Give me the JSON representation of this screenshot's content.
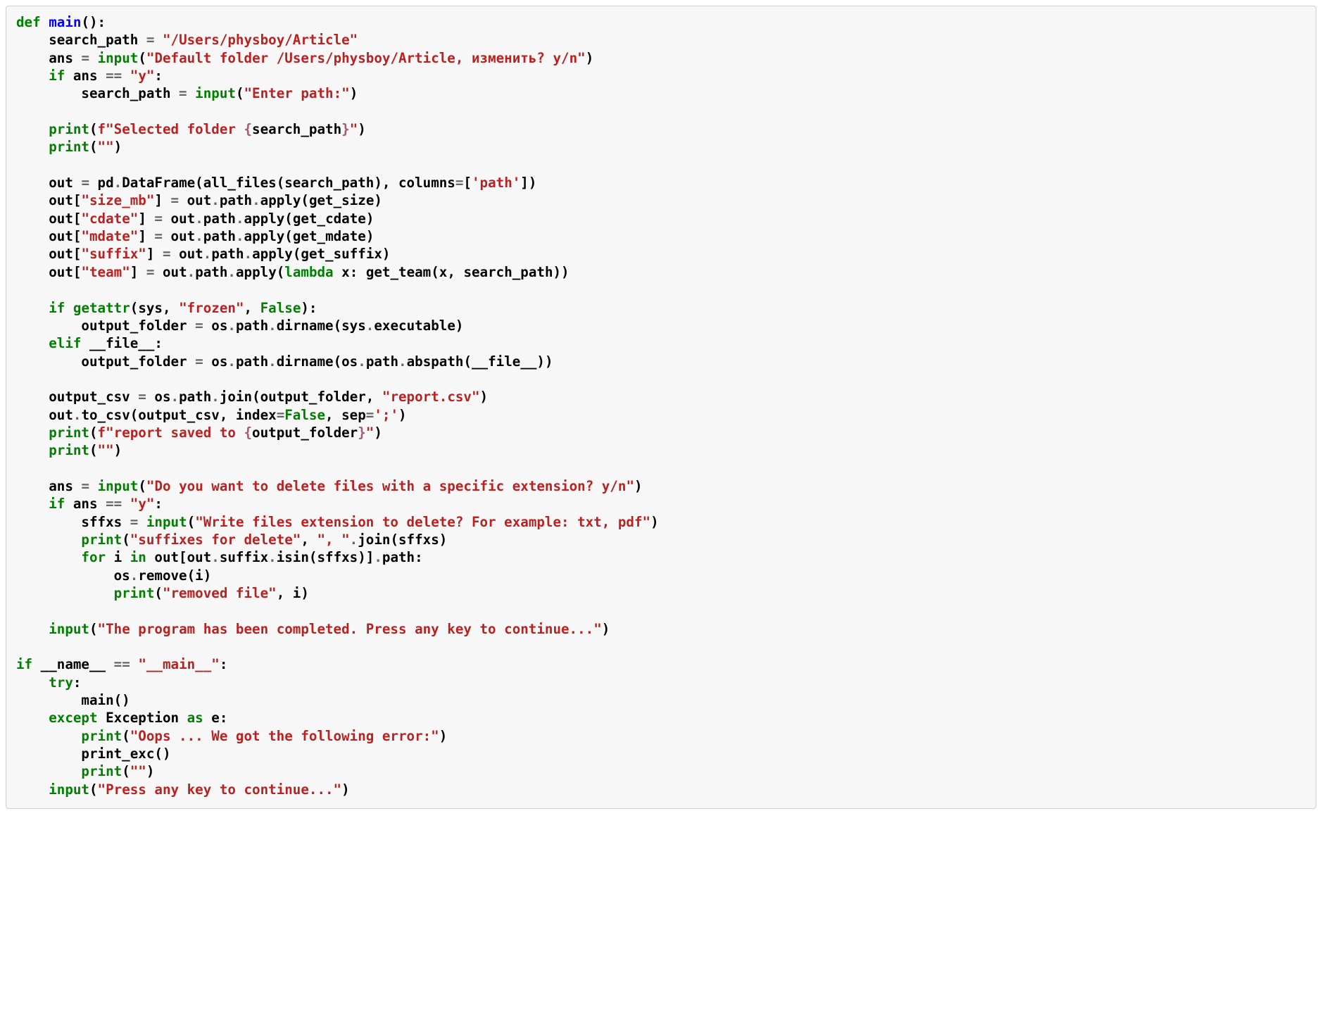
{
  "code": {
    "line1": {
      "def": "def",
      "sp": " ",
      "name": "main",
      "paren": "():"
    },
    "line2": {
      "indent": "    ",
      "v": "search_path ",
      "eq": "=",
      "sp": " ",
      "s": "\"/Users/physboy/Article\""
    },
    "line3": {
      "indent": "    ",
      "v": "ans ",
      "eq": "=",
      "sp": " ",
      "fn": "input",
      "open": "(",
      "s": "\"Default folder /Users/physboy/Article, изменить? y/n\"",
      "close": ")"
    },
    "line4": {
      "indent": "    ",
      "kw": "if",
      "cond": " ans ",
      "op": "==",
      "sp": " ",
      "s": "\"y\"",
      "colon": ":"
    },
    "line5": {
      "indent": "        ",
      "v": "search_path ",
      "eq": "=",
      "sp": " ",
      "fn": "input",
      "open": "(",
      "s": "\"Enter path:\"",
      "close": ")"
    },
    "line6": {
      "indent": "    ",
      "fn": "print",
      "open": "(",
      "pre": "f\"Selected folder ",
      "si_open": "{",
      "var": "search_path",
      "si_close": "}",
      "post": "\"",
      "close": ")"
    },
    "line7": {
      "indent": "    ",
      "fn": "print",
      "open": "(",
      "s": "\"\"",
      "close": ")"
    },
    "line8": {
      "indent": "    ",
      "lhs": "out ",
      "eq": "=",
      "rhs": " pd",
      "dot": ".",
      "m": "DataFrame(all_files(search_path), columns",
      "eq2": "=",
      "br": "[",
      "s": "'path'",
      "brc": "])"
    },
    "line9": {
      "indent": "    ",
      "lhs": "out[",
      "s": "\"size_mb\"",
      "mid": "] ",
      "eq": "=",
      "rhs": " out",
      "dot": ".",
      "tail": "path",
      "dot2": ".",
      "ap": "apply(get_size)"
    },
    "line10": {
      "indent": "    ",
      "lhs": "out[",
      "s": "\"cdate\"",
      "mid": "] ",
      "eq": "=",
      "rhs": " out",
      "dot": ".",
      "tail": "path",
      "dot2": ".",
      "ap": "apply(get_cdate)"
    },
    "line11": {
      "indent": "    ",
      "lhs": "out[",
      "s": "\"mdate\"",
      "mid": "] ",
      "eq": "=",
      "rhs": " out",
      "dot": ".",
      "tail": "path",
      "dot2": ".",
      "ap": "apply(get_mdate)"
    },
    "line12": {
      "indent": "    ",
      "lhs": "out[",
      "s": "\"suffix\"",
      "mid": "] ",
      "eq": "=",
      "rhs": " out",
      "dot": ".",
      "tail": "path",
      "dot2": ".",
      "ap": "apply(get_suffix)"
    },
    "line13": {
      "indent": "    ",
      "lhs": "out[",
      "s": "\"team\"",
      "mid": "] ",
      "eq": "=",
      "rhs": " out",
      "dot": ".",
      "tail": "path",
      "dot2": ".",
      "ap": "apply(",
      "kw": "lambda",
      "body": " x: get_team(x, search_path))"
    },
    "line14": {
      "indent": "    ",
      "kw": "if",
      "sp": " ",
      "fn": "getattr",
      "open": "(sys, ",
      "s": "\"frozen\"",
      "comma": ", ",
      "kc": "False",
      "close": "):"
    },
    "line15": {
      "indent": "        ",
      "v": "output_folder ",
      "eq": "=",
      "rhs": " os",
      "dot": ".",
      "tail": "path",
      "dot2": ".",
      "m": "dirname(sys",
      "dot3": ".",
      "exe": "executable)"
    },
    "line16": {
      "indent": "    ",
      "kw": "elif",
      "sp": " ",
      "v": "__file__",
      "colon": ":"
    },
    "line17": {
      "indent": "        ",
      "v": "output_folder ",
      "eq": "=",
      "rhs": " os",
      "dot": ".",
      "tail": "path",
      "dot2": ".",
      "m": "dirname(os",
      "dot3": ".",
      "p2": "path",
      "dot4": ".",
      "abs": "abspath(__file__))"
    },
    "line18": {
      "indent": "    ",
      "v": "output_csv ",
      "eq": "=",
      "rhs": " os",
      "dot": ".",
      "tail": "path",
      "dot2": ".",
      "m": "join(output_folder, ",
      "s": "\"report.csv\"",
      "close": ")"
    },
    "line19": {
      "indent": "    ",
      "lhs": "out",
      "dot": ".",
      "m": "to_csv(output_csv, index",
      "eq": "=",
      "kc": "False",
      "comma": ", sep",
      "eq2": "=",
      "s": "';'",
      "close": ")"
    },
    "line20": {
      "indent": "    ",
      "fn": "print",
      "open": "(",
      "pre": "f\"report saved to ",
      "si_open": "{",
      "var": "output_folder",
      "si_close": "}",
      "post": "\"",
      "close": ")"
    },
    "line21": {
      "indent": "    ",
      "fn": "print",
      "open": "(",
      "s": "\"\"",
      "close": ")"
    },
    "line22": {
      "indent": "    ",
      "v": "ans ",
      "eq": "=",
      "sp": " ",
      "fn": "input",
      "open": "(",
      "s": "\"Do you want to delete files with a specific extension? y/n\"",
      "close": ")"
    },
    "line23": {
      "indent": "    ",
      "kw": "if",
      "cond": " ans ",
      "op": "==",
      "sp": " ",
      "s": "\"y\"",
      "colon": ":"
    },
    "line24": {
      "indent": "        ",
      "v": "sffxs ",
      "eq": "=",
      "sp": " ",
      "fn": "input",
      "open": "(",
      "s": "\"Write files extension to delete? For example: txt, pdf\"",
      "close": ")"
    },
    "line25": {
      "indent": "        ",
      "fn": "print",
      "open": "(",
      "s": "\"suffixes for delete\"",
      "comma": ", ",
      "s2": "\", \"",
      "dot": ".",
      "m": "join(sffxs)"
    },
    "line26": {
      "indent": "        ",
      "kw": "for",
      "v": " i ",
      "kw2": "in",
      "body": " out[out",
      "dot": ".",
      "s1": "suffix",
      "dot2": ".",
      "isin": "isin(sffxs)]",
      "dot3": ".",
      "p": "path:"
    },
    "line27": {
      "indent": "            ",
      "lhs": "os",
      "dot": ".",
      "m": "remove(i)"
    },
    "line28": {
      "indent": "            ",
      "fn": "print",
      "open": "(",
      "s": "\"removed file\"",
      "comma": ", i)"
    },
    "line29": {
      "indent": "    ",
      "fn": "input",
      "open": "(",
      "s": "\"The program has been completed. Press any key to continue...\"",
      "close": ")"
    },
    "line30": {
      "kw": "if",
      "sp": " ",
      "v": "__name__ ",
      "op": "==",
      "sp2": " ",
      "s": "\"__main__\"",
      "colon": ":"
    },
    "line31": {
      "indent": "    ",
      "kw": "try",
      "colon": ":"
    },
    "line32": {
      "indent": "        ",
      "call": "main()"
    },
    "line33": {
      "indent": "    ",
      "kw": "except",
      "sp": " ",
      "exc": "Exception",
      "sp2": " ",
      "kw2": "as",
      "sp3": " ",
      "v": "e:"
    },
    "line34": {
      "indent": "        ",
      "fn": "print",
      "open": "(",
      "s": "\"Oops ... We got the following error:\"",
      "close": ")"
    },
    "line35": {
      "indent": "        ",
      "call": "print_exc()"
    },
    "line36": {
      "indent": "        ",
      "fn": "print",
      "open": "(",
      "s": "\"\"",
      "close": ")"
    },
    "line37": {
      "indent": "    ",
      "fn": "input",
      "open": "(",
      "s": "\"Press any key to continue...\"",
      "close": ")"
    }
  }
}
